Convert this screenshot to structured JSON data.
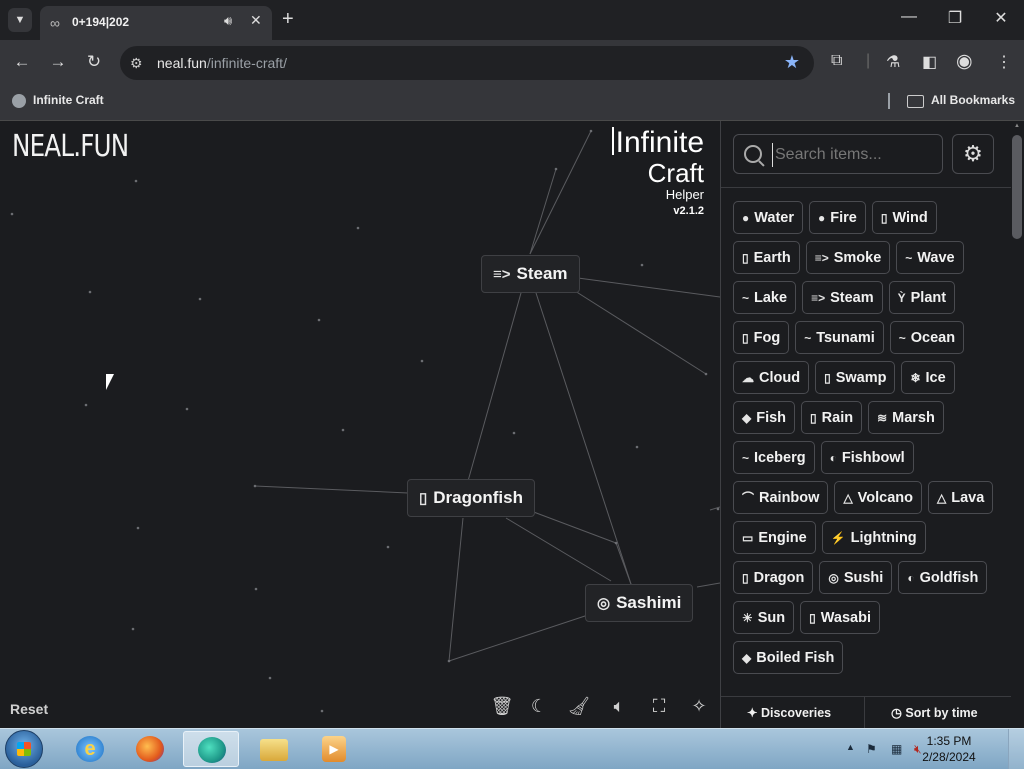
{
  "browser": {
    "tab_list_icon": "chevron-down-icon",
    "tab": {
      "favicon": "infinity-icon",
      "title": "0+194|202",
      "audio_icon": "speaker-icon",
      "close_icon": "close-icon"
    },
    "new_tab_icon": "plus-icon",
    "window_controls": [
      "minimize-icon",
      "restore-icon",
      "close-icon"
    ],
    "nav": {
      "back_icon": "back-arrow-icon",
      "forward_icon": "forward-arrow-icon",
      "reload_icon": "reload-icon"
    },
    "url_host": "neal.fun",
    "url_path": "/infinite-craft/",
    "bookmarks": {
      "item": "Infinite Craft",
      "all": "All Bookmarks"
    }
  },
  "page": {
    "logo": "NEAL.FUN",
    "brand": {
      "infinite": "Infinite",
      "craft": "Craft",
      "helper": "Helper",
      "version": "v2.1.2"
    },
    "canvas_nodes": [
      {
        "emoji": "≡>",
        "label": "Steam"
      },
      {
        "emoji": "▯",
        "label": "Dragonfish"
      },
      {
        "emoji": "◎",
        "label": "Sashimi"
      }
    ],
    "reset_label": "Reset",
    "bottom_tools": [
      "trash-can-icon",
      "moon-icon",
      "broom-icon",
      "volume-icon",
      "screenshot-icon",
      "sparkle-icon"
    ]
  },
  "sidebar": {
    "search_placeholder": "Search items...",
    "settings_icon": "gear-icon",
    "items": [
      {
        "emoji": "●",
        "label": "Water"
      },
      {
        "emoji": "●",
        "label": "Fire"
      },
      {
        "emoji": "▯",
        "label": "Wind"
      },
      {
        "emoji": "▯",
        "label": "Earth"
      },
      {
        "emoji": "≡>",
        "label": "Smoke"
      },
      {
        "emoji": "~",
        "label": "Wave"
      },
      {
        "emoji": "~",
        "label": "Lake"
      },
      {
        "emoji": "≡>",
        "label": "Steam"
      },
      {
        "emoji": "Ỳ",
        "label": "Plant"
      },
      {
        "emoji": "▯",
        "label": "Fog"
      },
      {
        "emoji": "~",
        "label": "Tsunami"
      },
      {
        "emoji": "~",
        "label": "Ocean"
      },
      {
        "emoji": "☁",
        "label": "Cloud"
      },
      {
        "emoji": "▯",
        "label": "Swamp"
      },
      {
        "emoji": "❄",
        "label": "Ice"
      },
      {
        "emoji": "◆",
        "label": "Fish"
      },
      {
        "emoji": "▯",
        "label": "Rain"
      },
      {
        "emoji": "≋",
        "label": "Marsh"
      },
      {
        "emoji": "~",
        "label": "Iceberg"
      },
      {
        "emoji": "◐",
        "label": "Fishbowl"
      },
      {
        "emoji": "⌒",
        "label": "Rainbow"
      },
      {
        "emoji": "△",
        "label": "Volcano"
      },
      {
        "emoji": "△",
        "label": "Lava"
      },
      {
        "emoji": "▭",
        "label": "Engine"
      },
      {
        "emoji": "⚡",
        "label": "Lightning"
      },
      {
        "emoji": "▯",
        "label": "Dragon"
      },
      {
        "emoji": "◎",
        "label": "Sushi"
      },
      {
        "emoji": "◐",
        "label": "Goldfish"
      },
      {
        "emoji": "☀",
        "label": "Sun"
      },
      {
        "emoji": "▯",
        "label": "Wasabi"
      },
      {
        "emoji": "◆",
        "label": "Boiled Fish"
      }
    ],
    "footer": {
      "discoveries": "Discoveries",
      "sort": "Sort by time"
    }
  },
  "taskbar": {
    "apps": [
      "internet-explorer-icon",
      "firefox-icon",
      "edge-icon",
      "file-explorer-icon",
      "media-player-icon"
    ],
    "time": "1:35 PM",
    "date": "2/28/2024"
  }
}
